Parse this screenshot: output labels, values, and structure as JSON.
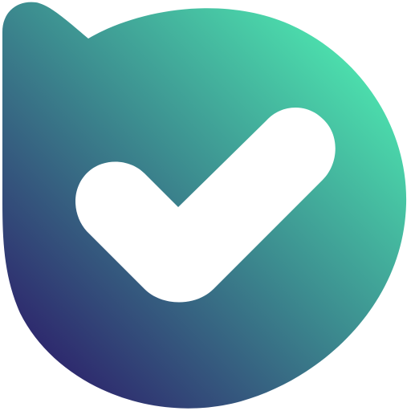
{
  "icon": {
    "name": "check-badge-icon",
    "gradient_start": "#2E2A6E",
    "gradient_mid": "#3C8B8F",
    "gradient_end": "#4EE8B0",
    "check_color": "#FFFFFF"
  }
}
